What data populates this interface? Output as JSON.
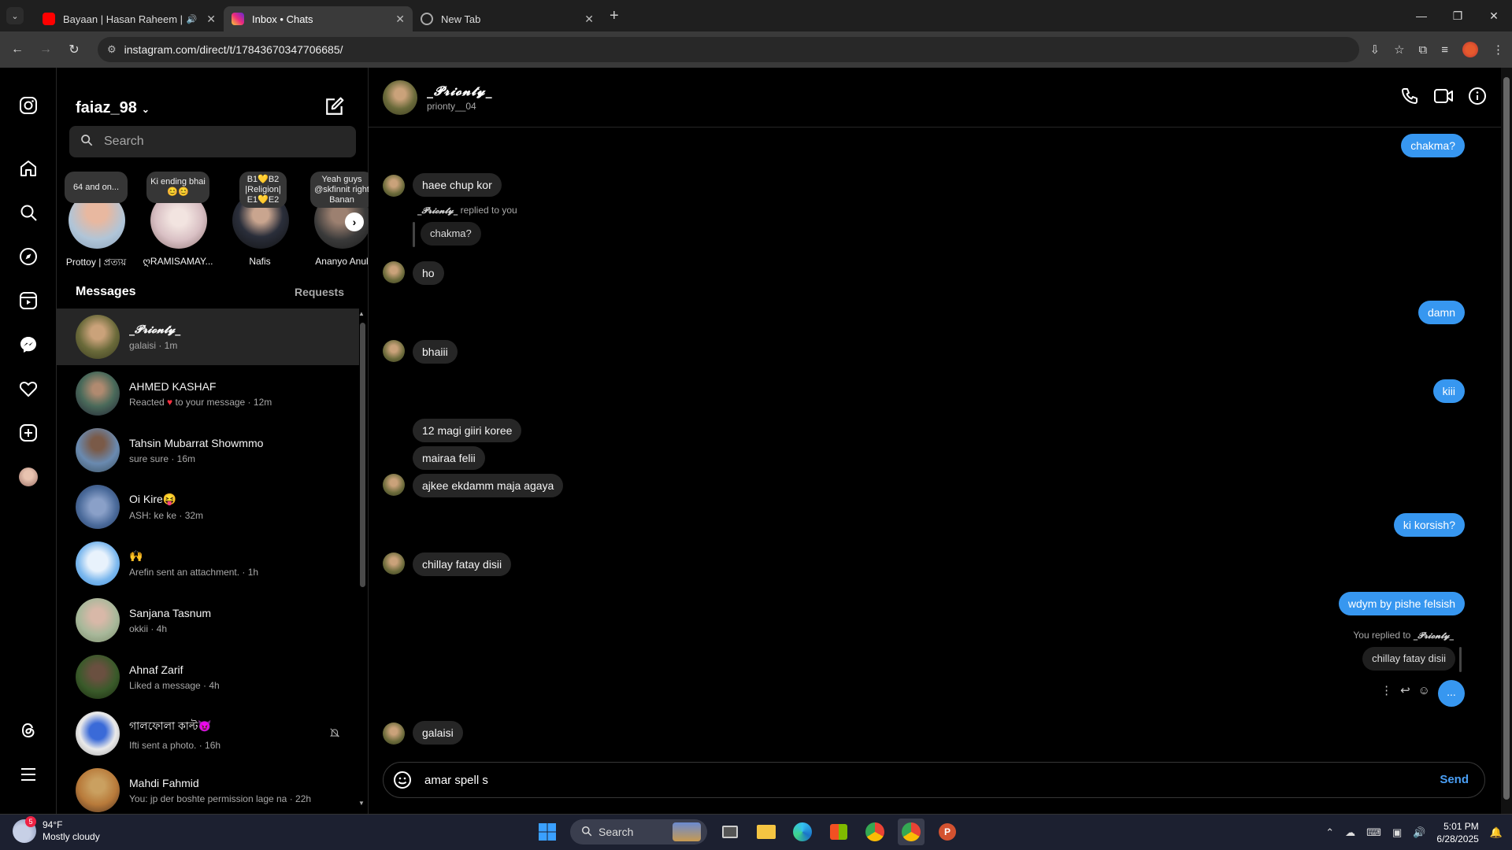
{
  "browser": {
    "tabs": [
      {
        "title": "Bayaan | Hasan Raheem | R",
        "favicon": "youtube-icon",
        "color": "#ff0000"
      },
      {
        "title": "Inbox • Chats",
        "favicon": "instagram-icon",
        "color": "#d62976"
      },
      {
        "title": "New Tab",
        "favicon": "chrome-icon",
        "color": "#888888"
      }
    ],
    "url": "instagram.com/direct/t/17843670347706685/"
  },
  "sidebar": {
    "account": "faiaz_98",
    "search_placeholder": "Search",
    "stories": [
      {
        "note": "64 and on...",
        "name": "Prottoy | প্রত্যয়"
      },
      {
        "note": "Ki ending bhai 😊😊",
        "name": "ღRAMISAMAY..."
      },
      {
        "note": "B1💛B2 |Religion| E1💛E2",
        "name": "Nafis"
      },
      {
        "note": "Yeah guys @skfinnit right Banan",
        "name": "Ananyo Anul"
      }
    ],
    "messages_label": "Messages",
    "requests_label": "Requests",
    "conversations": [
      {
        "name": "_𝓟𝓻𝓲𝓸𝓷𝓽𝔂_",
        "preview": "galaisi · 1m",
        "selected": true
      },
      {
        "name": "AHMED KASHAF",
        "preview_pre": "Reacted",
        "preview_heart": "♥",
        "preview_post": "to your message · 12m"
      },
      {
        "name": "Tahsin Mubarrat Showmmo",
        "preview": "sure sure · 16m"
      },
      {
        "name": "Oi Kire😝",
        "preview": "ASH: ke ke · 32m"
      },
      {
        "name": "🙌",
        "preview": "Arefin sent an attachment. · 1h"
      },
      {
        "name": "Sanjana Tasnum",
        "preview": "okkii · 4h"
      },
      {
        "name": "Ahnaf Zarif",
        "preview": "Liked a message · 4h"
      },
      {
        "name": "গালফোলা কাল্ট😈",
        "preview": "Ifti sent a photo. · 16h",
        "muted": true
      },
      {
        "name": "Mahdi Fahmid",
        "preview": "You: jp der boshte permission lage na · 22h"
      }
    ]
  },
  "chat": {
    "header_name": "_𝓟𝓻𝓲𝓸𝓷𝓽𝔂_",
    "header_username": "prionty__04",
    "messages": {
      "m1": "chakma?",
      "m2": "haee chup kor",
      "reply_name": "_𝓟𝓻𝓲𝓸𝓷𝓽𝔂_",
      "reply_suffix": "replied to you",
      "reply_quote": "chakma?",
      "m3": "ho",
      "m4": "damn",
      "m5": "bhaiii",
      "m6": "kiii",
      "m7": "12 magi  giiri koree",
      "m8": "mairaa felii",
      "m9": "ajkee ekdamm maja agaya",
      "m10": "ki korsish?",
      "m11": "chillay fatay disii",
      "m12": "wdym by pishe felsish",
      "you_replied_prefix": "You replied to",
      "you_replied_name": "_𝓟𝓻𝓲𝓸𝓷𝓽𝔂_",
      "you_replied_quote": "chillay fatay disii",
      "m13": "...",
      "m14": "galaisi"
    },
    "composer_value": "amar spell s",
    "send_label": "Send"
  },
  "taskbar": {
    "weather_badge": "5",
    "temp": "94°F",
    "condition": "Mostly cloudy",
    "search_label": "Search",
    "time": "5:01 PM",
    "date": "6/28/2025"
  }
}
